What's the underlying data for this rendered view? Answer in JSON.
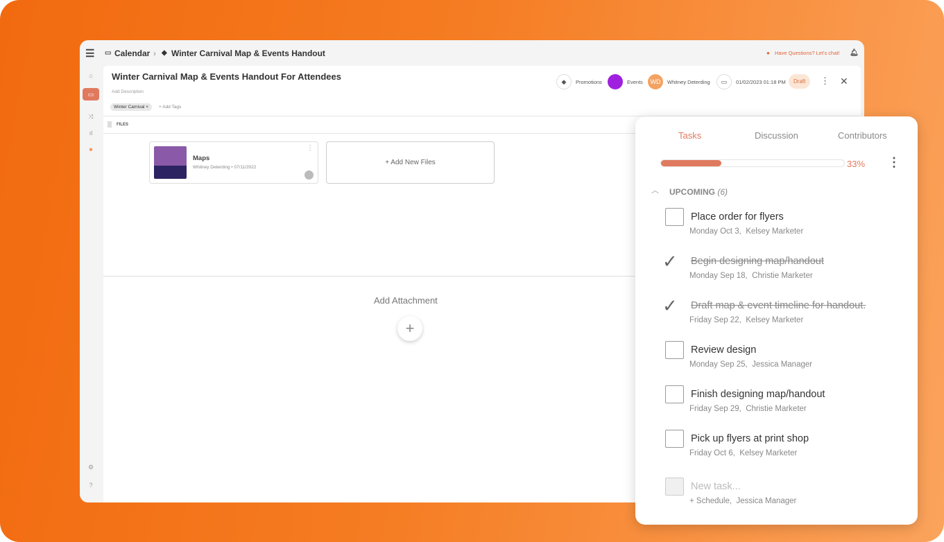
{
  "breadcrumb": {
    "root": "Calendar",
    "current": "Winter Carnival Map & Events Handout"
  },
  "help_link": "Have Questions? Let's chat!",
  "header": {
    "title": "Winter Carnival Map & Events Handout For Attendees",
    "description_placeholder": "Add Description",
    "tags": [
      {
        "label": "Winter Carnival"
      }
    ],
    "add_tags": "+ Add Tags",
    "category": "Promotions",
    "calendar": "Events",
    "calendar_color": "#a020e0",
    "owner_initials": "WD",
    "owner": "Whitney Deterding",
    "datetime": "01/02/2023 01:18 PM",
    "status": "Draft"
  },
  "files": {
    "section_label": "FILES",
    "items": [
      {
        "name": "Maps",
        "meta": "Whitney Deterding • 07/11/2022"
      }
    ],
    "add_label": "+ Add New Files"
  },
  "attachment": {
    "label": "Add Attachment",
    "add": "+"
  },
  "panel": {
    "tabs": [
      "Tasks",
      "Discussion",
      "Contributors"
    ],
    "active_tab": "Tasks",
    "progress_percent": 33,
    "progress_label": "33%",
    "group_label": "UPCOMING",
    "group_count": "(6)",
    "tasks": [
      {
        "title": "Place order for flyers",
        "date": "Monday Oct 3,",
        "assignee": "Kelsey Marketer",
        "done": false
      },
      {
        "title": "Begin designing map/handout",
        "date": "Monday Sep 18,",
        "assignee": "Christie Marketer",
        "done": true
      },
      {
        "title": "Draft map & event timeline for handout.",
        "date": "Friday Sep 22,",
        "assignee": "Kelsey Marketer",
        "done": true
      },
      {
        "title": "Review design",
        "date": "Monday Sep 25,",
        "assignee": "Jessica Manager",
        "done": false
      },
      {
        "title": "Finish designing map/handout",
        "date": "Friday Sep 29,",
        "assignee": "Christie Marketer",
        "done": false
      },
      {
        "title": "Pick up flyers at print shop",
        "date": "Friday Oct 6,",
        "assignee": "Kelsey Marketer",
        "done": false
      }
    ],
    "new_task": {
      "placeholder": "New task...",
      "schedule": "+ Schedule,",
      "assignee": "Jessica Manager"
    }
  },
  "colors": {
    "accent": "#e07a5f",
    "orange": "#f26a0f"
  }
}
